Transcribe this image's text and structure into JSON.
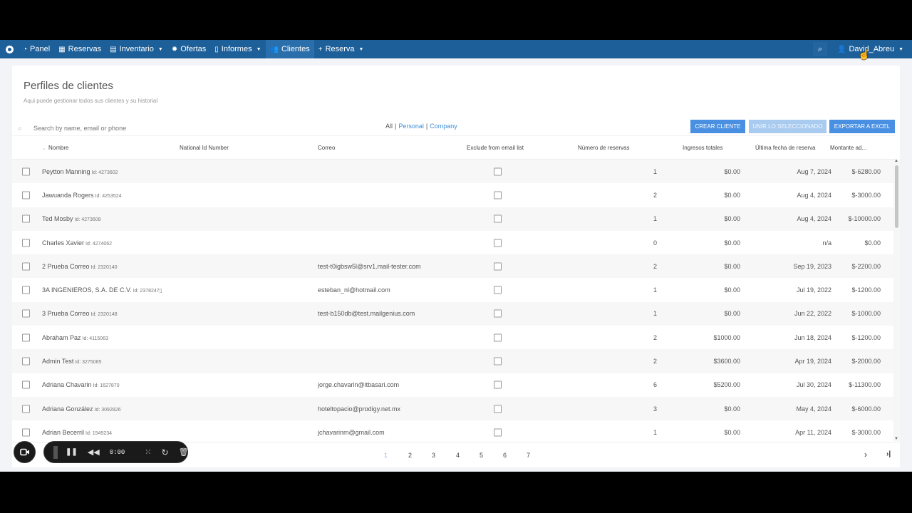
{
  "nav": {
    "items": [
      {
        "icon": "dashboard-icon",
        "glyph": "◔",
        "label": "Panel",
        "caret": false,
        "active": false
      },
      {
        "icon": "grid-icon",
        "glyph": "▦",
        "label": "Reservas",
        "caret": false,
        "active": false
      },
      {
        "icon": "database-icon",
        "glyph": "▤",
        "label": "Inventario",
        "caret": true,
        "active": false
      },
      {
        "icon": "gear-icon",
        "glyph": "✹",
        "label": "Ofertas",
        "caret": false,
        "active": false
      },
      {
        "icon": "file-icon",
        "glyph": "▯",
        "label": "Informes",
        "caret": true,
        "active": false
      },
      {
        "icon": "users-icon",
        "glyph": "👥",
        "label": "Clientes",
        "caret": false,
        "active": true
      },
      {
        "icon": "plus-icon",
        "glyph": "+",
        "label": "Reserva",
        "caret": true,
        "active": false
      }
    ],
    "user": "David_Abreu"
  },
  "page": {
    "title": "Perfiles de clientes",
    "subtitle": "Aqui puede gestionar todos sus clientes y su historial"
  },
  "search": {
    "placeholder": "Search by name, email or phone"
  },
  "filters": {
    "all": "All",
    "personal": "Personal",
    "company": "Company"
  },
  "buttons": {
    "create": "Crear cliente",
    "merge": "Unir lo seleccionado",
    "export": "Exportar a Excel"
  },
  "columns": {
    "nombre": "Nombre",
    "national_id": "National Id Number",
    "correo": "Correo",
    "exclude": "Exclude from email list",
    "reservas": "Número de reservas",
    "ingresos": "Ingresos totales",
    "fecha": "Última fecha de reserva",
    "montante": "Montante ad..."
  },
  "rows": [
    {
      "name": "Peytton Manning",
      "id": "Id: 4273602",
      "email": "",
      "reservas": "1",
      "ingresos": "$0.00",
      "fecha": "Aug 7, 2024",
      "montante": "$-6280.00"
    },
    {
      "name": "Jawuanda Rogers",
      "id": "Id: 4253524",
      "email": "",
      "reservas": "2",
      "ingresos": "$0.00",
      "fecha": "Aug 4, 2024",
      "montante": "$-3000.00"
    },
    {
      "name": "Ted Mosby",
      "id": "Id: 4273608",
      "email": "",
      "reservas": "1",
      "ingresos": "$0.00",
      "fecha": "Aug 4, 2024",
      "montante": "$-10000.00"
    },
    {
      "name": "Charles Xavier",
      "id": "Id: 4274062",
      "email": "",
      "reservas": "0",
      "ingresos": "$0.00",
      "fecha": "n/a",
      "montante": "$0.00"
    },
    {
      "name": "2 Prueba Correo",
      "id": "Id: 2320140",
      "email": "test-t0igbsw5l@srv1.mail-tester.com",
      "reservas": "2",
      "ingresos": "$0.00",
      "fecha": "Sep 19, 2023",
      "montante": "$-2200.00"
    },
    {
      "name": "3A INGENIEROS, S.A. DE C.V.",
      "id": "Id: 2378247▯",
      "email": "esteban_nl@hotmail.com",
      "reservas": "1",
      "ingresos": "$0.00",
      "fecha": "Jul 19, 2022",
      "montante": "$-1200.00"
    },
    {
      "name": "3 Prueba Correo",
      "id": "Id: 2320148",
      "email": "test-b150db@test.mailgenius.com",
      "reservas": "1",
      "ingresos": "$0.00",
      "fecha": "Jun 22, 2022",
      "montante": "$-1000.00"
    },
    {
      "name": "Abraham Paz",
      "id": "Id: 4115063",
      "email": "",
      "reservas": "2",
      "ingresos": "$1000.00",
      "fecha": "Jun 18, 2024",
      "montante": "$-1200.00"
    },
    {
      "name": "Admin Test",
      "id": "Id: 3275085",
      "email": "",
      "reservas": "2",
      "ingresos": "$3600.00",
      "fecha": "Apr 19, 2024",
      "montante": "$-2000.00"
    },
    {
      "name": "Adriana Chavarin",
      "id": "Id: 1627870",
      "email": "jorge.chavarin@itbasari.com",
      "reservas": "6",
      "ingresos": "$5200.00",
      "fecha": "Jul 30, 2024",
      "montante": "$-11300.00"
    },
    {
      "name": "Adriana González",
      "id": "Id: 3092826",
      "email": "hoteltopacio@prodigy.net.mx",
      "reservas": "3",
      "ingresos": "$0.00",
      "fecha": "May 4, 2024",
      "montante": "$-6000.00"
    },
    {
      "name": "Adrian Becerril",
      "id": "Id: 1549234",
      "email": "jchavarinm@gmail.com",
      "reservas": "1",
      "ingresos": "$0.00",
      "fecha": "Apr 11, 2024",
      "montante": "$-3000.00"
    }
  ],
  "pagination": {
    "pages": [
      "1",
      "2",
      "3",
      "4",
      "5",
      "6",
      "7"
    ],
    "current": "1",
    "next": "›",
    "last": "›|"
  },
  "recorder": {
    "time": "0:00"
  }
}
